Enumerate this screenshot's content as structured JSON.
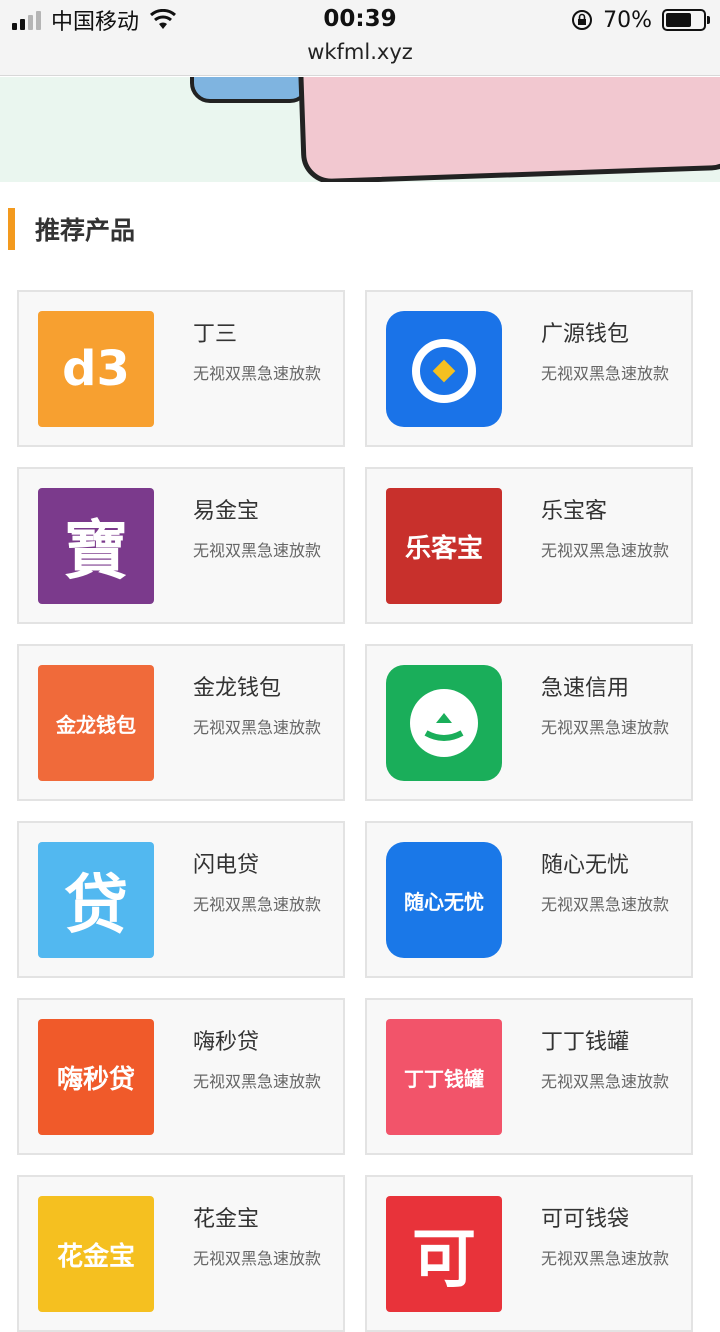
{
  "status_bar": {
    "carrier": "中国移动",
    "time": "00:39",
    "url": "wkfml.xyz",
    "battery": "70%",
    "battery_level": 0.7
  },
  "section": {
    "title": "推荐产品"
  },
  "products": [
    {
      "name": "丁三",
      "desc": "无视双黑急速放款",
      "logo_text": "d3",
      "icon": "d3-logo-icon",
      "color": "#f7a030"
    },
    {
      "name": "广源钱包",
      "desc": "无视双黑急速放款",
      "logo_text": "",
      "icon": "dragon-logo-icon",
      "color": "#1a73e8"
    },
    {
      "name": "易金宝",
      "desc": "无视双黑急速放款",
      "logo_text": "寶",
      "icon": "bao-logo-icon",
      "color": "#7b3a8c"
    },
    {
      "name": "乐宝客",
      "desc": "无视双黑急速放款",
      "logo_text": "乐客宝",
      "icon": "lekebao-logo-icon",
      "color": "#c8302c"
    },
    {
      "name": "金龙钱包",
      "desc": "无视双黑急速放款",
      "logo_text": "金龙钱包",
      "icon": "golden-dragon-logo-icon",
      "color": "#f06a3a"
    },
    {
      "name": "急速信用",
      "desc": "无视双黑急速放款",
      "logo_text": "",
      "icon": "credit-logo-icon",
      "color": "#1aae5a"
    },
    {
      "name": "闪电贷",
      "desc": "无视双黑急速放款",
      "logo_text": "贷",
      "icon": "lightning-loan-logo-icon",
      "color": "#52b8f0"
    },
    {
      "name": "随心无忧",
      "desc": "无视双黑急速放款",
      "logo_text": "随心无忧",
      "icon": "yen-bag-logo-icon",
      "color": "#1a78e8"
    },
    {
      "name": "嗨秒贷",
      "desc": "无视双黑急速放款",
      "logo_text": "嗨秒贷",
      "icon": "stopwatch-logo-icon",
      "color": "#f05a2a"
    },
    {
      "name": "丁丁钱罐",
      "desc": "无视双黑急速放款",
      "logo_text": "丁丁钱罐",
      "icon": "money-jar-logo-icon",
      "color": "#f2546a"
    },
    {
      "name": "花金宝",
      "desc": "无视双黑急速放款",
      "logo_text": "花金宝",
      "icon": "cat-logo-icon",
      "color": "#f5c020"
    },
    {
      "name": "可可钱袋",
      "desc": "无视双黑急速放款",
      "logo_text": "可",
      "icon": "money-bag-logo-icon",
      "color": "#e8333a"
    }
  ]
}
